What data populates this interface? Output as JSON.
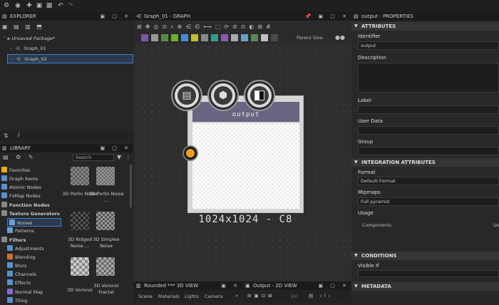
{
  "topbar": {
    "icons": [
      "app-menu-icon",
      "globe-icon",
      "add-icon",
      "save-icon",
      "share-icon",
      "undo-icon",
      "redo-icon"
    ]
  },
  "explorer": {
    "title": "EXPLORER",
    "package": "Unsaved Package*",
    "items": [
      {
        "label": "Graph_01"
      },
      {
        "label": "Graph_02"
      }
    ]
  },
  "library": {
    "title": "LIBRARY",
    "search_placeholder": "Search",
    "categories": [
      {
        "label": "Favorites",
        "color": "#e6b400"
      },
      {
        "label": "Graph Items",
        "color": "#5a8fd0"
      },
      {
        "label": "Atomic Nodes",
        "color": "#5a8fd0"
      },
      {
        "label": "FxMap Nodes",
        "color": "#5a8fd0"
      },
      {
        "label": "Function Nodes",
        "color": "#888888"
      },
      {
        "label": "Texture Generators",
        "color": "#888888"
      },
      {
        "label": "Noises",
        "color": "#6a9fd8"
      },
      {
        "label": "Patterns",
        "color": "#6a9fd8"
      },
      {
        "label": "Filters",
        "color": "#888888"
      },
      {
        "label": "Adjustments",
        "color": "#5a8fd0"
      },
      {
        "label": "Blending",
        "color": "#d07030"
      },
      {
        "label": "Blurs",
        "color": "#5a8fd0"
      },
      {
        "label": "Channels",
        "color": "#5a8fd0"
      },
      {
        "label": "Effects",
        "color": "#5a8fd0"
      },
      {
        "label": "Normal Map",
        "color": "#8a6ad0"
      },
      {
        "label": "Tiling",
        "color": "#5a8fd0"
      }
    ],
    "thumbs": [
      {
        "label": "3D Perlin Noise"
      },
      {
        "label": "3D Perlin Noise ..."
      },
      {
        "label": "3D Ridged Noise ..."
      },
      {
        "label": "3D Simplex Noise"
      },
      {
        "label": "3D Voronoi"
      },
      {
        "label": "3D Voronoi Fractal"
      }
    ]
  },
  "graph": {
    "title": "Graph_01 - GRAPH",
    "parent_size_label": "Parent Size:",
    "node": {
      "title": "output",
      "resolution": "1024x1024 - C8"
    }
  },
  "properties": {
    "title": "output - PROPERTIES",
    "attributes_section": "ATTRIBUTES",
    "identifier_label": "Identifier",
    "identifier_value": "output",
    "description_label": "Description",
    "label_label": "Label",
    "user_data_label": "User Data",
    "group_label": "Group",
    "integration_section": "INTEGRATION ATTRIBUTES",
    "format_label": "Format",
    "format_value": "Default Format",
    "mipmaps_label": "Mipmaps",
    "mipmaps_value": "Full pyramid",
    "usage_label": "Usage",
    "components_label": "Components",
    "usage_cut": "Us",
    "conditions_section": "CONDITIONS",
    "visible_if_label": "Visible If",
    "metadata_section": "METADATA"
  },
  "bottom": {
    "view3d_title": "Rounded *** 3D VIEW",
    "view3d_tabs": [
      "Scene",
      "Materials",
      "Lights",
      "Camera"
    ],
    "view2d_title": "Output - 2D VIEW",
    "uv_label": "UV"
  }
}
